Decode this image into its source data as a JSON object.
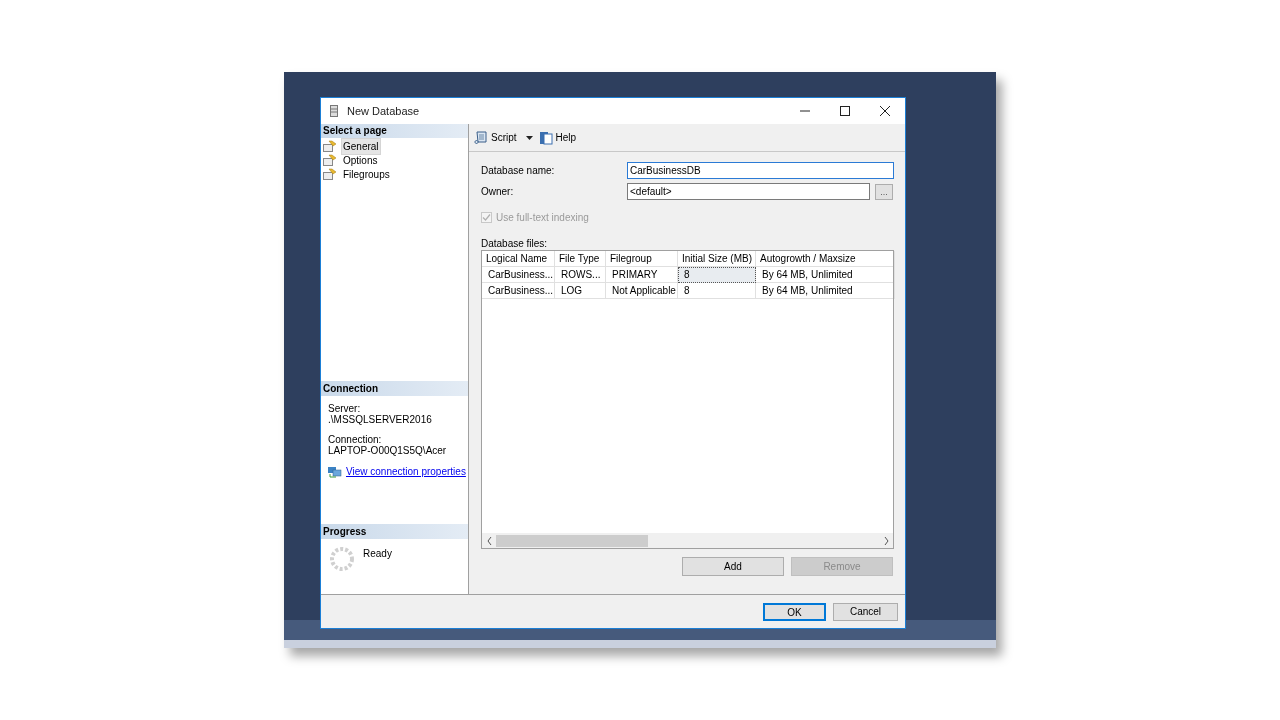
{
  "window": {
    "title": "New Database"
  },
  "sidebar": {
    "header": "Select a page",
    "items": [
      {
        "label": "General",
        "selected": true
      },
      {
        "label": "Options",
        "selected": false
      },
      {
        "label": "Filegroups",
        "selected": false
      }
    ]
  },
  "connection": {
    "header": "Connection",
    "server_label": "Server:",
    "server": ".\\MSSQLSERVER2016",
    "connection_label": "Connection:",
    "connection": "LAPTOP-O00Q1S5Q\\Acer",
    "link": "View connection properties"
  },
  "progress": {
    "header": "Progress",
    "status": "Ready"
  },
  "toolbar": [
    {
      "kind": "dropdown",
      "label": "Script"
    },
    {
      "kind": "plain",
      "label": "Help"
    }
  ],
  "form": {
    "database_name_label": "Database name:",
    "database_name": "CarBusinessDB",
    "owner_label": "Owner:",
    "owner": "<default>",
    "browse_button": "...",
    "fulltext": {
      "label": "Use full-text indexing",
      "checked": true,
      "disabled": true
    }
  },
  "files": {
    "label": "Database files:",
    "columns": [
      "Logical Name",
      "File Type",
      "Filegroup",
      "Initial Size (MB)",
      "Autogrowth / Maxsize"
    ],
    "rows": [
      {
        "cells": [
          {
            "text": "CarBusiness...",
            "focused": false
          },
          {
            "text": "ROWS...",
            "focused": false
          },
          {
            "text": "PRIMARY",
            "focused": false
          },
          {
            "text": "8",
            "focused": true
          },
          {
            "text": "By 64 MB, Unlimited",
            "focused": false
          }
        ]
      },
      {
        "cells": [
          {
            "text": "CarBusiness...",
            "focused": false
          },
          {
            "text": "LOG",
            "focused": false
          },
          {
            "text": "Not Applicable",
            "focused": false
          },
          {
            "text": "8",
            "focused": false
          },
          {
            "text": "By 64 MB, Unlimited",
            "focused": false
          }
        ]
      }
    ]
  },
  "grid_buttons": [
    {
      "label": "Add",
      "disabled": false
    },
    {
      "label": "Remove",
      "disabled": true
    }
  ],
  "dialog_buttons": [
    {
      "label": "OK",
      "default": true
    },
    {
      "label": "Cancel",
      "default": false
    }
  ]
}
